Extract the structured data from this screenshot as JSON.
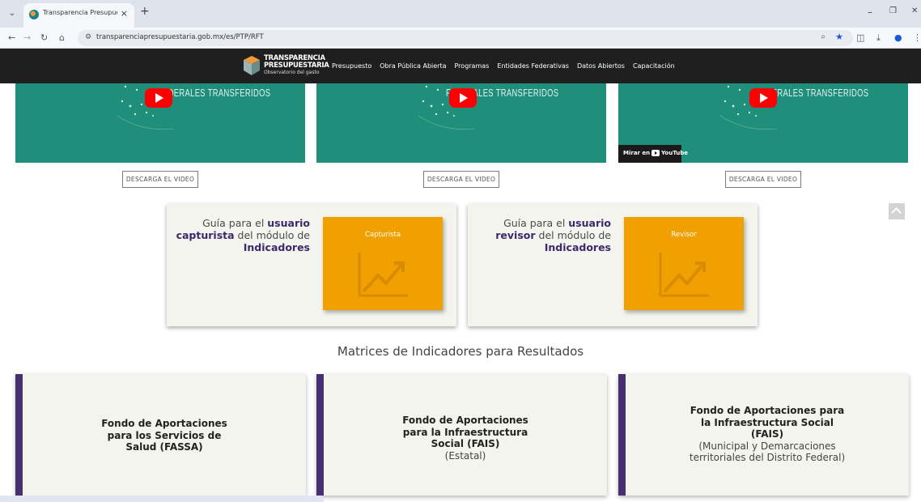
{
  "browser": {
    "tab_title": "Transparencia Presupuestaria | ",
    "tab_close": "×",
    "new_tab": "+",
    "url": "transparenciapresupuestaria.gob.mx/es/PTP/RFT",
    "minimize": "–",
    "maximize": "❐",
    "close": "✕"
  },
  "header": {
    "logo_line1": "TRANSPARENCIA",
    "logo_line2": "PRESUPUESTARIA",
    "logo_line3": "Observatorio del gasto",
    "nav": [
      "Presupuesto",
      "Obra Pública Abierta",
      "Programas",
      "Entidades Federativas",
      "Datos Abiertos",
      "Capacitación"
    ]
  },
  "videos": [
    {
      "title": "FEDERALES TRANSFERIDOS",
      "download": "DESCARGA EL VIDEO"
    },
    {
      "title": "FEDERALES TRANSFERIDOS",
      "download": "DESCARGA EL VIDEO"
    },
    {
      "title": "FEDERALES TRANSFERIDOS",
      "download": "DESCARGA EL VIDEO",
      "watch_on": "Mirar en",
      "youtube": "YouTube"
    }
  ],
  "guides": [
    {
      "pre": "Guía para el ",
      "bold1": "usuario capturista",
      "mid": " del módulo de ",
      "bold2": "Indicadores",
      "button": "Capturista"
    },
    {
      "pre": "Guía para el ",
      "bold1": "usuario revisor",
      "mid": " del módulo de ",
      "bold2": "Indicadores",
      "button": "Revisor"
    }
  ],
  "mir": {
    "title": "Matrices de Indicadores para Resultados",
    "cards": [
      {
        "bold": "Fondo de Aportaciones para los Servicios de Salud (FASSA)",
        "sub": ""
      },
      {
        "bold": "Fondo de Aportaciones para la Infraestructura Social (FAIS)",
        "sub": "(Estatal)"
      },
      {
        "bold": "Fondo de Aportaciones para la Infraestructura Social (FAIS)",
        "sub": "(Municipal y Demarcaciones territoriales del Distrito Federal)"
      }
    ]
  },
  "colors": {
    "teal": "#1f8f7b",
    "orange": "#f0a000",
    "purple": "#46306f",
    "header_bg": "#1f1f1f"
  }
}
